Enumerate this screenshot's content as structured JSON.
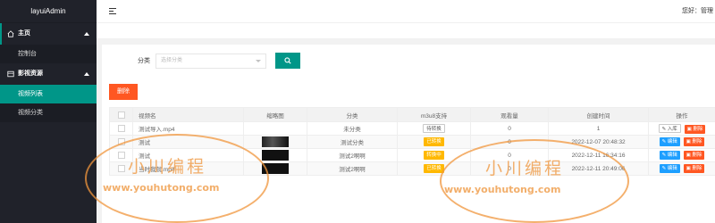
{
  "app": {
    "logo": "layuiAdmin"
  },
  "sidebar": {
    "groups": [
      {
        "label": "主页",
        "icon": "home-icon",
        "items": [
          {
            "label": "控制台",
            "active": false
          }
        ]
      },
      {
        "label": "影视资源",
        "icon": "film-icon",
        "items": [
          {
            "label": "视频列表",
            "active": true
          },
          {
            "label": "视频分类",
            "active": false
          }
        ]
      }
    ]
  },
  "header": {
    "menu_icon": "menu-icon",
    "greeting": "您好：管理"
  },
  "filter": {
    "label": "分类",
    "select_placeholder": "选择分类",
    "search_icon": "search-icon"
  },
  "toolbar": {
    "delete_label": "删除"
  },
  "table": {
    "columns": [
      "视频名",
      "缩略图",
      "分类",
      "m3u8支持",
      "观看量",
      "创建时间",
      "操作"
    ],
    "rows": [
      {
        "name": "测试导入.mp4",
        "category": "未分类",
        "m3u8": "待转换",
        "views": "0",
        "created": "1",
        "ops": [
          "入库",
          "删除"
        ]
      },
      {
        "name": "测试",
        "category": "测试分类",
        "m3u8": "已转换",
        "views": "0",
        "created": "2022-12-07 20:48:32",
        "ops": [
          "编辑",
          "删除"
        ]
      },
      {
        "name": "测试",
        "category": "测试2啊啊",
        "m3u8": "转换中",
        "views": "0",
        "created": "2022-12-11 16:34:16",
        "ops": [
          "编辑",
          "删除"
        ]
      },
      {
        "name": "当时我就.mp4",
        "category": "测试2啊啊",
        "m3u8": "已转换",
        "views": "0",
        "created": "2022-12-11 20:49:06",
        "ops": [
          "编辑",
          "删除"
        ]
      }
    ]
  },
  "watermark": {
    "title": "小川编程",
    "url": "www.youhutong.com"
  }
}
